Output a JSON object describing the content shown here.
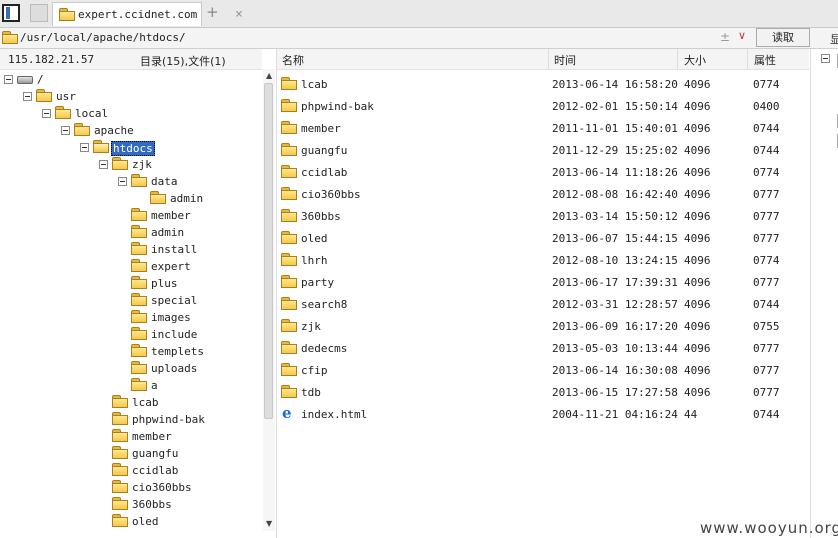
{
  "tab": {
    "title": "expert.ccidnet.com",
    "close": "×",
    "new_tab": "+"
  },
  "address": {
    "path": "/usr/local/apache/htdocs/",
    "plus": "±",
    "dropdown": "∨",
    "read_button": "读取",
    "right_label": "显"
  },
  "left": {
    "ip": "115.182.21.57",
    "summary": "目录(15),文件(1)"
  },
  "tree": [
    {
      "label": "/",
      "indent": 0,
      "toggle": true,
      "icon": "drive"
    },
    {
      "label": "usr",
      "indent": 1,
      "toggle": true,
      "icon": "folder"
    },
    {
      "label": "local",
      "indent": 2,
      "toggle": true,
      "icon": "folder"
    },
    {
      "label": "apache",
      "indent": 3,
      "toggle": true,
      "icon": "folder"
    },
    {
      "label": "htdocs",
      "indent": 4,
      "toggle": true,
      "icon": "folder-open",
      "selected": true
    },
    {
      "label": "zjk",
      "indent": 5,
      "toggle": true,
      "icon": "folder"
    },
    {
      "label": "data",
      "indent": 6,
      "toggle": true,
      "icon": "folder"
    },
    {
      "label": "admin",
      "indent": 7,
      "toggle": false,
      "icon": "folder"
    },
    {
      "label": "member",
      "indent": 6,
      "toggle": false,
      "icon": "folder"
    },
    {
      "label": "admin",
      "indent": 6,
      "toggle": false,
      "icon": "folder"
    },
    {
      "label": "install",
      "indent": 6,
      "toggle": false,
      "icon": "folder"
    },
    {
      "label": "expert",
      "indent": 6,
      "toggle": false,
      "icon": "folder"
    },
    {
      "label": "plus",
      "indent": 6,
      "toggle": false,
      "icon": "folder"
    },
    {
      "label": "special",
      "indent": 6,
      "toggle": false,
      "icon": "folder"
    },
    {
      "label": "images",
      "indent": 6,
      "toggle": false,
      "icon": "folder"
    },
    {
      "label": "include",
      "indent": 6,
      "toggle": false,
      "icon": "folder"
    },
    {
      "label": "templets",
      "indent": 6,
      "toggle": false,
      "icon": "folder"
    },
    {
      "label": "uploads",
      "indent": 6,
      "toggle": false,
      "icon": "folder"
    },
    {
      "label": "a",
      "indent": 6,
      "toggle": false,
      "icon": "folder"
    },
    {
      "label": "lcab",
      "indent": 5,
      "toggle": false,
      "icon": "folder"
    },
    {
      "label": "phpwind-bak",
      "indent": 5,
      "toggle": false,
      "icon": "folder"
    },
    {
      "label": "member",
      "indent": 5,
      "toggle": false,
      "icon": "folder"
    },
    {
      "label": "guangfu",
      "indent": 5,
      "toggle": false,
      "icon": "folder"
    },
    {
      "label": "ccidlab",
      "indent": 5,
      "toggle": false,
      "icon": "folder"
    },
    {
      "label": "cio360bbs",
      "indent": 5,
      "toggle": false,
      "icon": "folder"
    },
    {
      "label": "360bbs",
      "indent": 5,
      "toggle": false,
      "icon": "folder"
    },
    {
      "label": "oled",
      "indent": 5,
      "toggle": false,
      "icon": "folder"
    }
  ],
  "scroll": {
    "up": "▲",
    "down": "▼"
  },
  "columns": {
    "name": "名称",
    "time": "时间",
    "size": "大小",
    "attr": "属性"
  },
  "files": [
    {
      "name": "lcab",
      "time": "2013-06-14 16:58:20",
      "size": "4096",
      "attr": "0774",
      "icon": "folder"
    },
    {
      "name": "phpwind-bak",
      "time": "2012-02-01 15:50:14",
      "size": "4096",
      "attr": "0400",
      "icon": "folder"
    },
    {
      "name": "member",
      "time": "2011-11-01 15:40:01",
      "size": "4096",
      "attr": "0744",
      "icon": "folder"
    },
    {
      "name": "guangfu",
      "time": "2011-12-29 15:25:02",
      "size": "4096",
      "attr": "0744",
      "icon": "folder"
    },
    {
      "name": "ccidlab",
      "time": "2013-06-14 11:18:26",
      "size": "4096",
      "attr": "0774",
      "icon": "folder"
    },
    {
      "name": "cio360bbs",
      "time": "2012-08-08 16:42:40",
      "size": "4096",
      "attr": "0777",
      "icon": "folder"
    },
    {
      "name": "360bbs",
      "time": "2013-03-14 15:50:12",
      "size": "4096",
      "attr": "0777",
      "icon": "folder"
    },
    {
      "name": "oled",
      "time": "2013-06-07 15:44:15",
      "size": "4096",
      "attr": "0777",
      "icon": "folder"
    },
    {
      "name": "lhrh",
      "time": "2012-08-10 13:24:15",
      "size": "4096",
      "attr": "0774",
      "icon": "folder"
    },
    {
      "name": "party",
      "time": "2013-06-17 17:39:31",
      "size": "4096",
      "attr": "0777",
      "icon": "folder"
    },
    {
      "name": "search8",
      "time": "2012-03-31 12:28:57",
      "size": "4096",
      "attr": "0744",
      "icon": "folder"
    },
    {
      "name": "zjk",
      "time": "2013-06-09 16:17:20",
      "size": "4096",
      "attr": "0755",
      "icon": "folder"
    },
    {
      "name": "dedecms",
      "time": "2013-05-03 10:13:44",
      "size": "4096",
      "attr": "0777",
      "icon": "folder"
    },
    {
      "name": "cfip",
      "time": "2013-06-14 16:30:08",
      "size": "4096",
      "attr": "0777",
      "icon": "folder"
    },
    {
      "name": "tdb",
      "time": "2013-06-15 17:27:58",
      "size": "4096",
      "attr": "0777",
      "icon": "folder"
    },
    {
      "name": "index.html",
      "time": "2004-11-21 04:16:24",
      "size": "44",
      "attr": "0744",
      "icon": "ie-file"
    }
  ],
  "watermark": "www.wooyun.org"
}
